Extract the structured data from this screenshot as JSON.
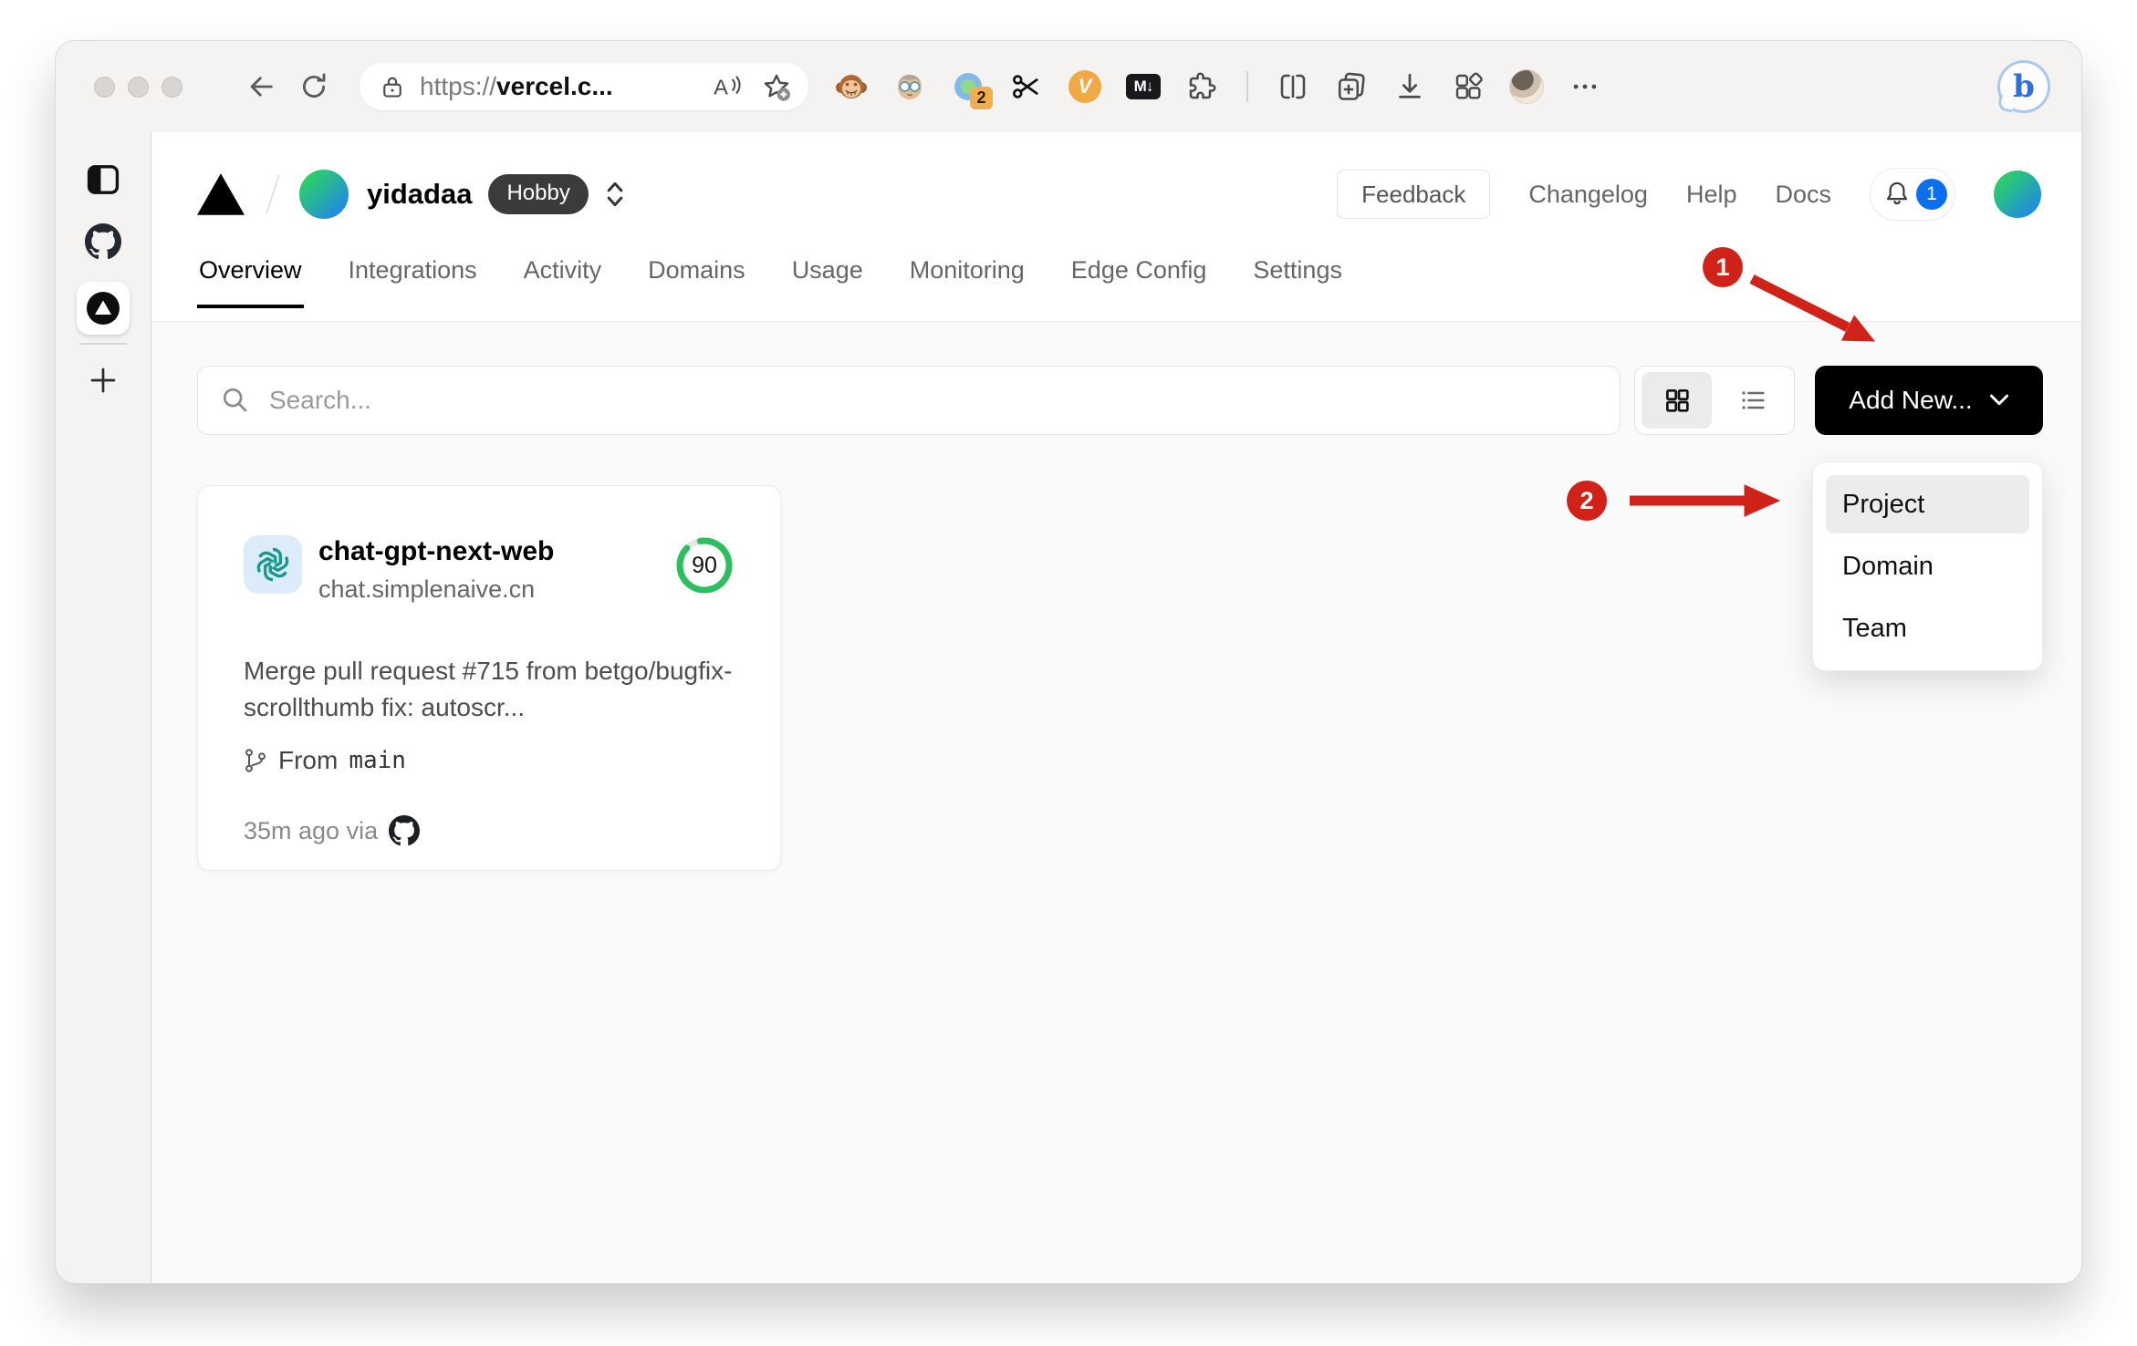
{
  "browser": {
    "url_scheme": "https://",
    "url_host": "vercel.c...",
    "extension_badge": "2",
    "vc_label": "V",
    "md_label": "M↓",
    "bing_label": "b"
  },
  "vercel": {
    "team_name": "yidadaa",
    "plan": "Hobby",
    "feedback": "Feedback",
    "changelog": "Changelog",
    "help": "Help",
    "docs": "Docs",
    "notification_count": "1",
    "tabs": [
      {
        "label": "Overview"
      },
      {
        "label": "Integrations"
      },
      {
        "label": "Activity"
      },
      {
        "label": "Domains"
      },
      {
        "label": "Usage"
      },
      {
        "label": "Monitoring"
      },
      {
        "label": "Edge Config"
      },
      {
        "label": "Settings"
      }
    ],
    "search_placeholder": "Search...",
    "add_new": "Add New...",
    "dropdown": [
      {
        "label": "Project"
      },
      {
        "label": "Domain"
      },
      {
        "label": "Team"
      }
    ],
    "card": {
      "name": "chat-gpt-next-web",
      "domain": "chat.simplenaive.cn",
      "score": "90",
      "commit": "Merge pull request #715 from betgo/bugfix-scrollthumb fix: autoscr...",
      "branch_label": "From",
      "branch": "main",
      "deployed": "35m ago via"
    }
  },
  "annotations": {
    "step1": "1",
    "step2": "2"
  },
  "colors": {
    "annotation_red": "#d1221a",
    "score_green": "#2dbe60",
    "badge_blue": "#0b6ff0",
    "button_black": "#000000",
    "avatar_gradient_start": "#2dd65c",
    "avatar_gradient_end": "#1f86eb"
  }
}
